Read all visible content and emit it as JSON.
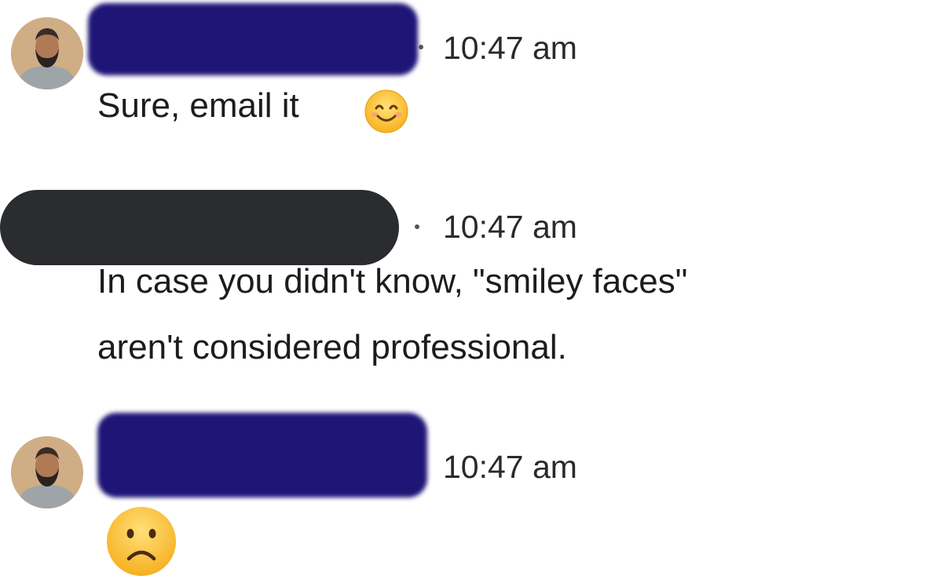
{
  "messages": [
    {
      "sender_redacted": true,
      "timestamp": "10:47 am",
      "text": "Sure, email it",
      "emoji": "smiling-face-icon"
    },
    {
      "sender_redacted": true,
      "timestamp": "10:47 am",
      "text_line1": "In case you didn't know, \"smiley faces\"",
      "text_line2": "aren't considered professional."
    },
    {
      "sender_redacted": true,
      "timestamp": "10:47 am",
      "emoji": "frowning-face-icon"
    }
  ],
  "colors": {
    "redaction_blue": "#1f1577",
    "redaction_dark": "#2b2c2f",
    "avatar_bg": "#cfae86",
    "emoji_yellow": "#ffc83d"
  }
}
